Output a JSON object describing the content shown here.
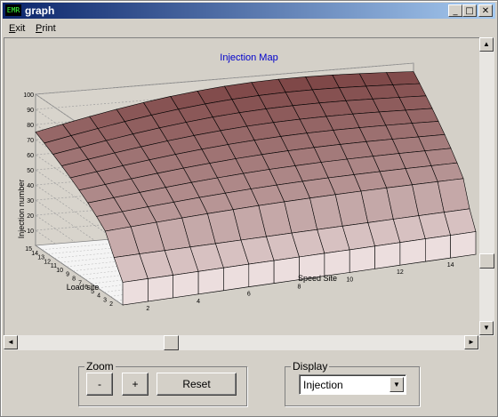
{
  "window": {
    "title": "graph",
    "icon_text": "EMR",
    "controls": {
      "minimize": "_",
      "maximize": "□",
      "close": "✕"
    }
  },
  "menu": {
    "items": [
      {
        "label": "Exit",
        "accel": "E",
        "rest": "xit"
      },
      {
        "label": "Print",
        "accel": "P",
        "rest": "rint"
      }
    ]
  },
  "chart_data": {
    "type": "surface3d",
    "title": "Injection Map",
    "zlabel": "Injection number",
    "xlabel": "Speed Site",
    "ylabel": "Load site",
    "z_ticks": [
      "10",
      "20",
      "30",
      "40",
      "50",
      "60",
      "70",
      "80",
      "90",
      "100"
    ],
    "x_ticks": [
      "2",
      "4",
      "6",
      "8",
      "10",
      "12",
      "14"
    ],
    "y_ticks": [
      "2",
      "3",
      "4",
      "5",
      "6",
      "7",
      "8",
      "9",
      "10",
      "11",
      "12",
      "13",
      "14",
      "15"
    ],
    "zlim": [
      0,
      100
    ],
    "x_range": [
      1,
      15
    ],
    "y_range": [
      1,
      15
    ],
    "colors": {
      "surface_top": "#7a3a3a",
      "surface_bottom": "#f0e4e4",
      "title": "#0000cc"
    }
  },
  "scroll": {
    "up": "▲",
    "down": "▼",
    "left": "◄",
    "right": "►"
  },
  "zoom": {
    "label": "Zoom",
    "minus": "-",
    "plus": "+",
    "reset": "Reset"
  },
  "display": {
    "label": "Display",
    "selected": "Injection",
    "arrow": "▼"
  }
}
